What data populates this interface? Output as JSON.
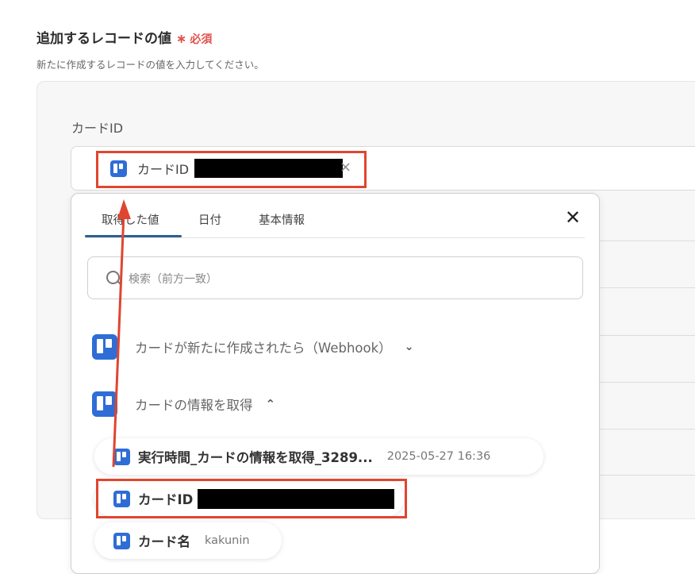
{
  "section": {
    "title": "追加するレコードの値",
    "required_star": "∗",
    "required_label": "必須",
    "description": "新たに作成するレコードの値を入力してください。"
  },
  "field": {
    "label": "カードID",
    "chip_label": "カードID",
    "chip_icon": "trello-icon"
  },
  "dropdown": {
    "tabs": [
      {
        "label": "取得した値",
        "active": true
      },
      {
        "label": "日付",
        "active": false
      },
      {
        "label": "基本情報",
        "active": false
      }
    ],
    "close": "✕",
    "search_placeholder": "検索（前方一致）",
    "groups": [
      {
        "label": "カードが新たに作成されたら（Webhook）",
        "state": "collapsed"
      },
      {
        "label": "カードの情報を取得",
        "state": "expanded"
      }
    ],
    "items": [
      {
        "label": "実行時間_カードの情報を取得_3289...",
        "value": "2025-05-27 16:36"
      },
      {
        "label": "カードID",
        "value": ""
      },
      {
        "label": "カード名",
        "value": "kakunin"
      }
    ]
  },
  "colors": {
    "accent": "#2f5f8f",
    "required": "#e0524e",
    "highlight": "#e0452f",
    "trello": "#2f6dd6"
  }
}
